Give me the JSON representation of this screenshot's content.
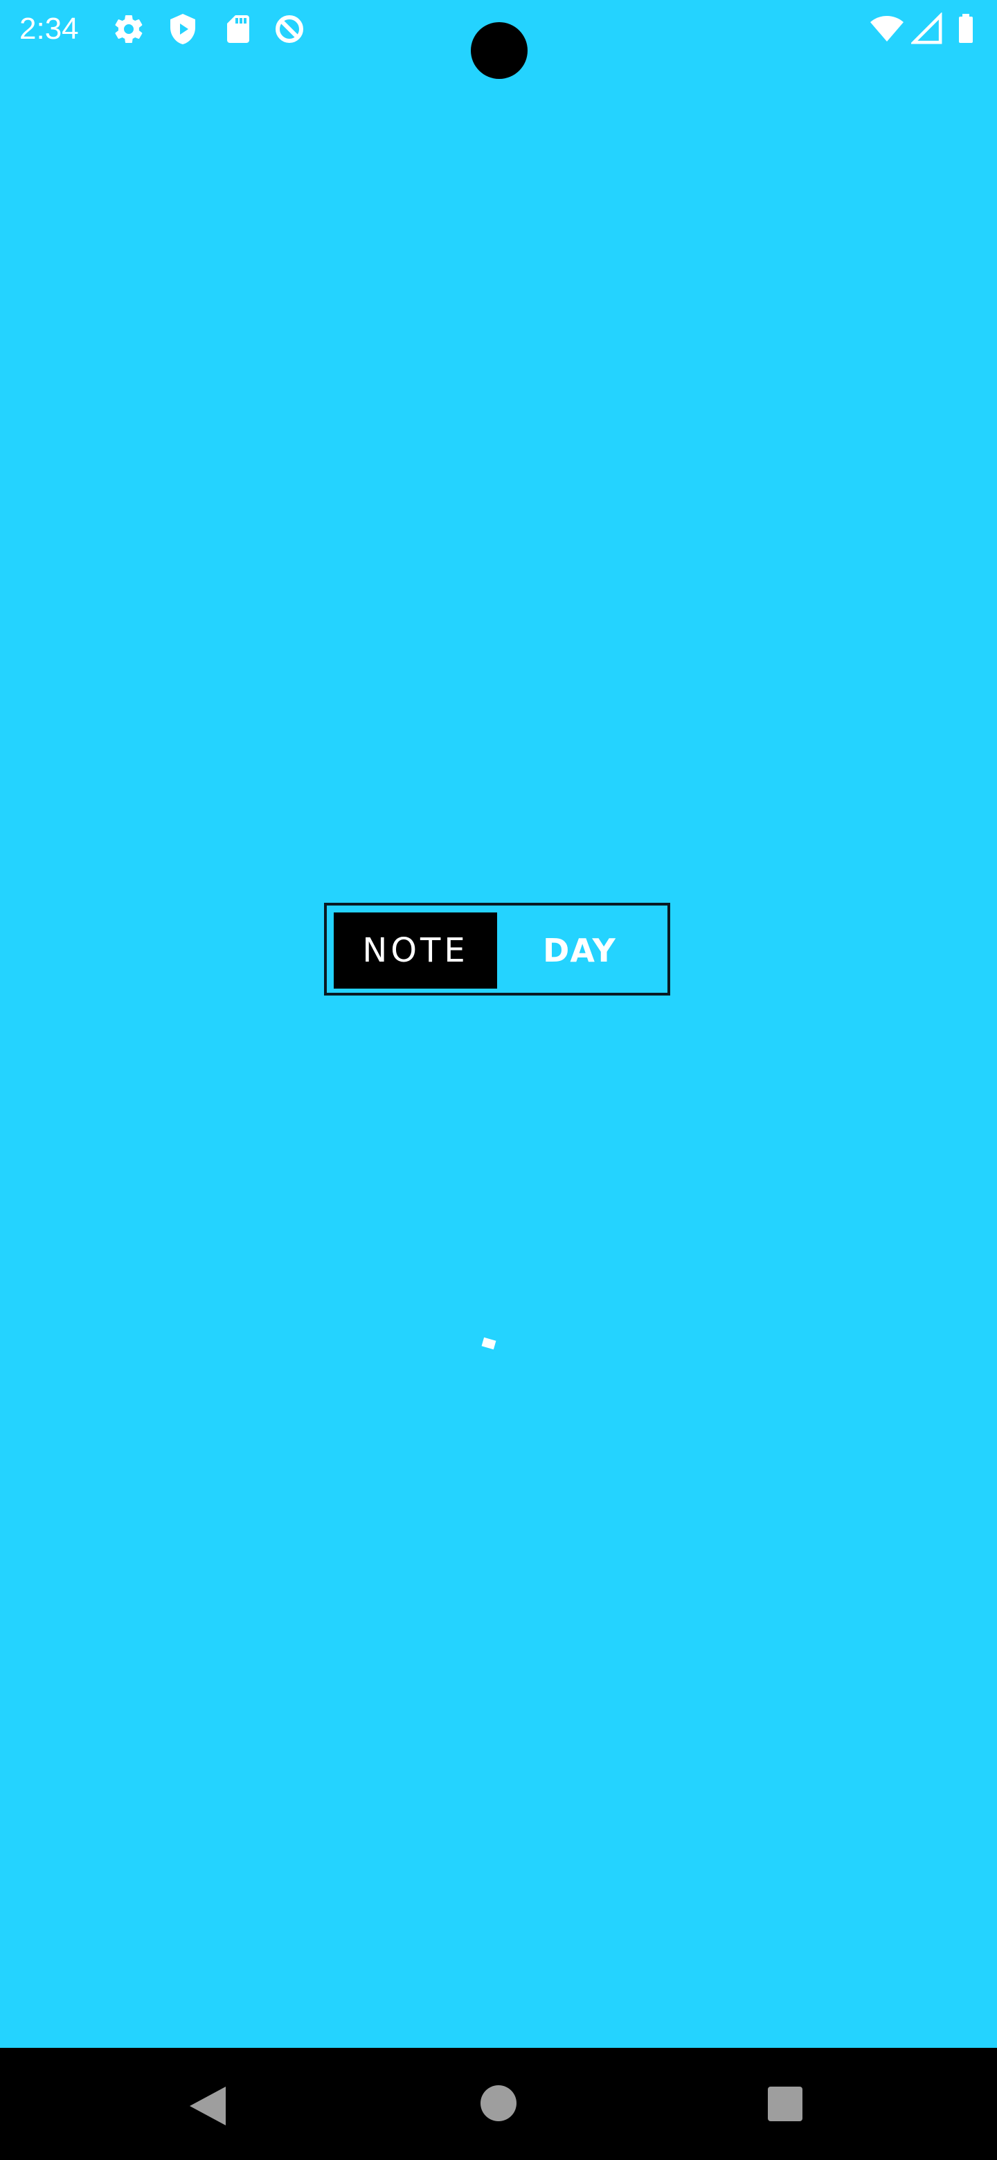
{
  "status_bar": {
    "time": "2:34",
    "left_icons": [
      "gear-icon",
      "shield-play-icon",
      "sd-card-icon",
      "data-saver-icon"
    ],
    "right_icons": [
      "wifi-icon",
      "cell-signal-icon",
      "battery-icon"
    ]
  },
  "logo": {
    "part1": "NOTE",
    "part2": "DAY"
  },
  "colors": {
    "background": "#24d3ff",
    "logo_box": "#000000",
    "text": "#ffffff",
    "nav_bar": "#000000",
    "nav_icons": "#9e9e9e"
  },
  "nav_bar": {
    "buttons": [
      "back-icon",
      "home-icon",
      "recents-icon"
    ]
  }
}
